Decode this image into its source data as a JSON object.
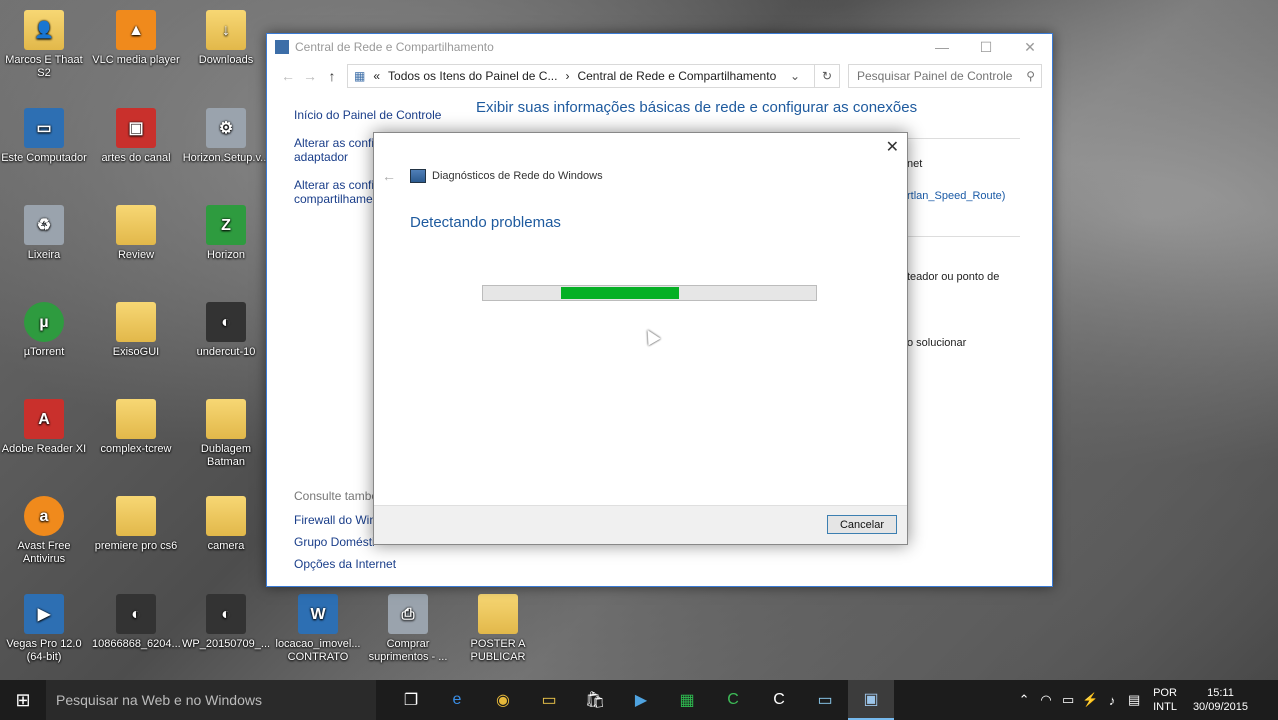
{
  "desktop": {
    "icons": [
      {
        "label": "Marcos E Thaat\nS2",
        "icon": "user-folder-icon"
      },
      {
        "label": "VLC media player",
        "icon": "vlc-icon"
      },
      {
        "label": "Downloads",
        "icon": "downloads-folder-icon"
      },
      {
        "label": "Este Computador",
        "icon": "computer-icon"
      },
      {
        "label": "artes do canal",
        "icon": "image-folder-icon"
      },
      {
        "label": "Horizon.Setup.v...",
        "icon": "setup-icon"
      },
      {
        "label": "Lixeira",
        "icon": "recycle-bin-icon"
      },
      {
        "label": "Review",
        "icon": "folder-icon"
      },
      {
        "label": "Horizon",
        "icon": "horizon-app-icon"
      },
      {
        "label": "µTorrent",
        "icon": "utorrent-icon"
      },
      {
        "label": "ExisoGUI",
        "icon": "folder-icon"
      },
      {
        "label": "undercut-10",
        "icon": "photo-icon"
      },
      {
        "label": "Adobe Reader XI",
        "icon": "adobe-reader-icon"
      },
      {
        "label": "complex-tcrew",
        "icon": "folder-icon"
      },
      {
        "label": "Dublagem\nBatman",
        "icon": "folder-icon"
      },
      {
        "label": "Avast Free\nAntivirus",
        "icon": "avast-icon"
      },
      {
        "label": "premiere pro cs6",
        "icon": "folder-icon"
      },
      {
        "label": "camera",
        "icon": "folder-icon"
      },
      {
        "label": "Vegas Pro 12.0\n(64-bit)",
        "icon": "vegas-icon"
      },
      {
        "label": "10866868_6204...",
        "icon": "photo-icon"
      },
      {
        "label": "WP_20150709_...",
        "icon": "photo-icon"
      },
      {
        "label": "locacao_imovel...\nCONTRATO",
        "icon": "word-doc-icon"
      },
      {
        "label": "Comprar\nsuprimentos - ...",
        "icon": "printer-icon"
      },
      {
        "label": "POSTER A\nPUBLICAR",
        "icon": "folder-icon"
      }
    ]
  },
  "control_panel": {
    "title": "Central de Rede e Compartilhamento",
    "address": {
      "chevron": "«",
      "crumb1": "Todos os Itens do Painel de C...",
      "crumb2": "Central de Rede e Compartilhamento"
    },
    "search_placeholder": "Pesquisar Painel de Controle",
    "left_links": {
      "home": "Início do Painel de Controle",
      "adapter_line1": "Alterar as config",
      "adapter_line2": "adaptador",
      "sharing_line1": "Alterar as config",
      "sharing_line2": "compartilhamer",
      "see_also": "Consulte també",
      "firewall": "Firewall do Wind",
      "homegroup": "Grupo Domésti",
      "internet_options": "Opções da Internet"
    },
    "main_title": "Exibir suas informações básicas de rede e configurar as conexões",
    "fragments": {
      "net": "net",
      "route": "rtlan_Speed_Route)",
      "router": "teador ou ponto de",
      "solve": "o solucionar"
    }
  },
  "dialog": {
    "header": "Diagnósticos de Rede do Windows",
    "status": "Detectando problemas",
    "progress": {
      "start": 0.235,
      "end": 0.59
    },
    "cancel_label": "Cancelar"
  },
  "taskbar": {
    "search_placeholder": "Pesquisar na Web e no Windows",
    "apps": [
      "task-view-icon",
      "edge-icon",
      "chrome-icon",
      "file-explorer-icon",
      "store-icon",
      "video-app-icon",
      "spreadsheet-app-icon",
      "camtasia-icon",
      "camtasia-dark-icon",
      "window-app-icon",
      "network-diagnostics-icon"
    ],
    "lang_line1": "POR",
    "lang_line2": "INTL",
    "time": "15:11",
    "date": "30/09/2015"
  },
  "colors": {
    "accent_blue": "#1e5a9e",
    "progress_green": "#06b025",
    "window_border": "#3a7bd5"
  }
}
